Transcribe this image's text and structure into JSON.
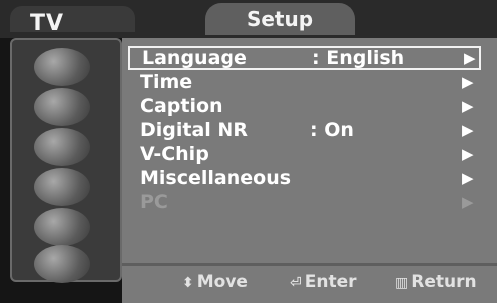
{
  "header": {
    "tv_label": "TV",
    "menu_title": "Setup"
  },
  "sidebar": {
    "icons": [
      "picture-icon",
      "sound-icon",
      "channel-icon",
      "setup-icon",
      "input-icon",
      "digital-icon"
    ]
  },
  "menu": {
    "items": [
      {
        "label": "Language",
        "value": ":  English",
        "arrow": "▶"
      },
      {
        "label": "Time",
        "value": "",
        "arrow": "▶"
      },
      {
        "label": "Caption",
        "value": "",
        "arrow": "▶"
      },
      {
        "label": "Digital NR",
        "value": ":  On",
        "arrow": "▶"
      },
      {
        "label": "V-Chip",
        "value": "",
        "arrow": "▶"
      },
      {
        "label": "Miscellaneous",
        "value": "",
        "arrow": "▶"
      },
      {
        "label": "PC",
        "value": "",
        "arrow": "▶"
      }
    ],
    "selected_index": 0,
    "disabled_index": 6
  },
  "footer": {
    "move_icon": "⬍",
    "move_label": "Move",
    "enter_icon": "⏎",
    "enter_label": "Enter",
    "return_icon": "▥",
    "return_label": "Return"
  },
  "colors": {
    "panel": "#7a7a7a",
    "sidebar": "#3b3b3b",
    "text": "#ffffff"
  }
}
